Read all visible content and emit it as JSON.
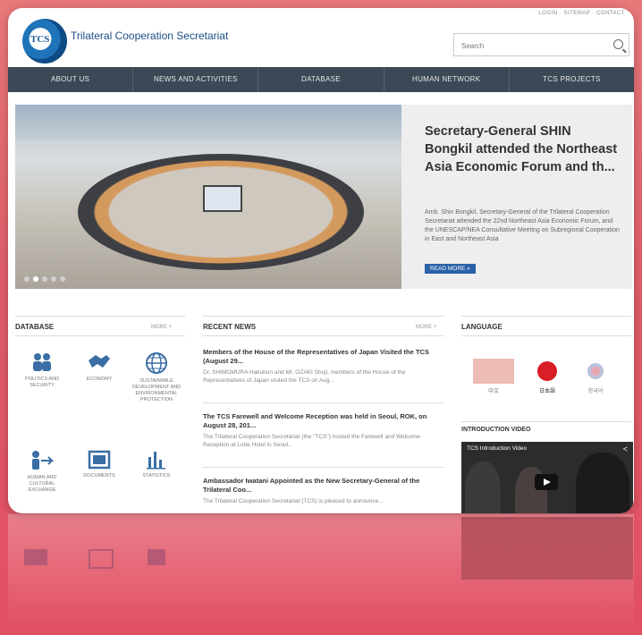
{
  "header": {
    "logo_text": "TCS",
    "site_title": "Trilateral Cooperation Secretariat",
    "top_links": "LOGIN · SITEMAP · CONTACT",
    "search_placeholder": "Search"
  },
  "nav": [
    "ABOUT US",
    "NEWS AND ACTIVITIES",
    "DATABASE",
    "HUMAN NETWORK",
    "TCS PROJECTS"
  ],
  "hero": {
    "title": "Secretary-General SHIN Bongkil attended the Northeast Asia Economic Forum and th...",
    "body": "Amb. Shin Bongkil, Secretary-General of the Trilateral Cooperation Secretariat attended the 22nd Northeast Asia Economic Forum, and the UNESCAP/NEA Consultative Meeting on Subregional Cooperation in East and Northeast Asia",
    "read_more": "READ MORE »",
    "slide_count": 5,
    "active_slide": 2
  },
  "database": {
    "heading": "DATABASE",
    "more": "MORE +",
    "items": [
      {
        "label": "POLITICS AND SECURITY",
        "icon": "people-icon"
      },
      {
        "label": "ECONOMY",
        "icon": "handshake-icon"
      },
      {
        "label": "SUSTAINABLE DEVELOPMENT AND ENVIRONMENTAL PROTECTION",
        "icon": "globe-icon"
      },
      {
        "label": "HUMAN AND CULTURAL EXCHANGE",
        "icon": "exchange-icon"
      },
      {
        "label": "DOCUMENTS",
        "icon": "document-icon"
      },
      {
        "label": "STATISTICS",
        "icon": "bar-chart-icon"
      }
    ]
  },
  "recent_news": {
    "heading": "RECENT NEWS",
    "more": "MORE +",
    "items": [
      {
        "title": "Members of the House of the Representatives of Japan Visited the TCS (August 29...",
        "desc": "Dr. SHIMOMURA Hakubun and Mr. OZAKI Shoji, members of the House of the Representatives of Japan visited the TCS on Aug..."
      },
      {
        "title": "The TCS Farewell and Welcome Reception was held in Seoul, ROK, on August 28, 201...",
        "desc": "The Trilateral Cooperation Secretariat (the \"TCS\") hosted the Farewell and Welcome Reception at Lotte Hotel in Seoul..."
      },
      {
        "title": "Ambassador Iwatani Appointed as the New Secretary-General of the Trilateral Coo...",
        "desc": "The Trilateral Cooperation Secretariat (TCS) is pleased to announce..."
      }
    ]
  },
  "language": {
    "heading": "LANGUAGE",
    "items": [
      {
        "label": "中文",
        "icon": "china-flag-icon",
        "color": "#e8b4ae"
      },
      {
        "label": "日本語",
        "icon": "japan-flag-icon",
        "color": "#d81e26"
      },
      {
        "label": "한국어",
        "icon": "korea-flag-icon",
        "color": "#c9c9d6"
      }
    ]
  },
  "intro_video": {
    "heading": "INTRODUCTION VIDEO",
    "title": "TCS Introduction Video"
  },
  "colors": {
    "nav_bg": "#3b4956",
    "accent": "#2a62a8",
    "page_bg": "#e05d6a"
  }
}
